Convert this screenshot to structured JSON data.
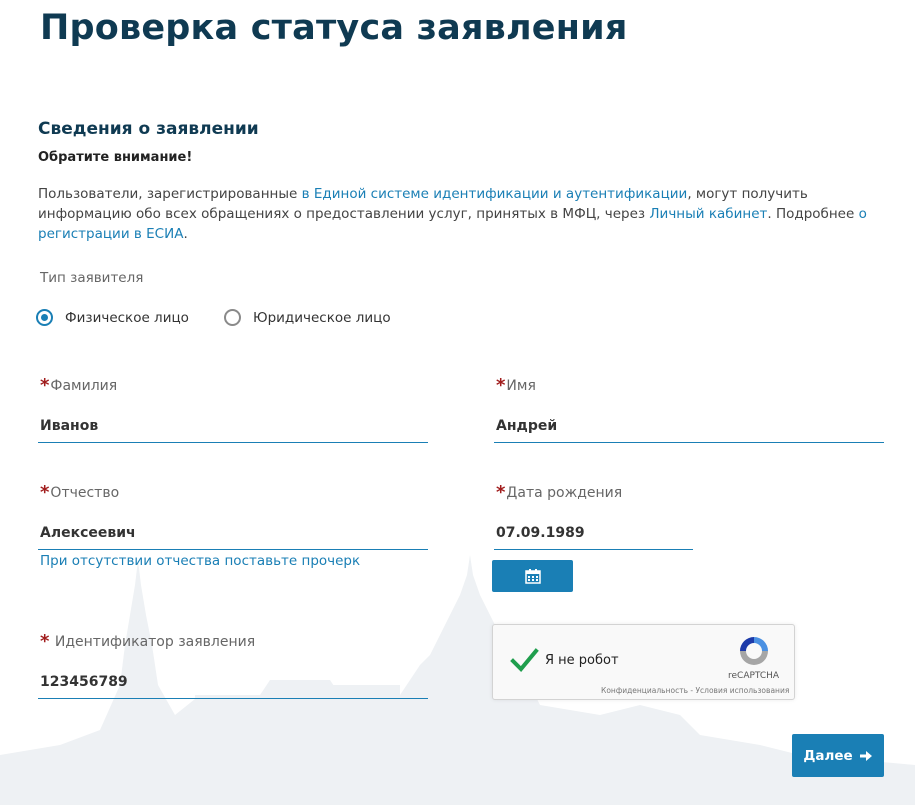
{
  "page": {
    "title": "Проверка статуса заявления"
  },
  "section": {
    "title": "Сведения о заявлении",
    "attention": "Обратите внимание!",
    "info": {
      "text1": "Пользователи, зарегистрированные ",
      "link1": "в Единой системе идентификации и аутентификации",
      "text2": ", могут получить информацию обо всех обращениях о предоставлении услуг, принятых в МФЦ, через ",
      "link2": "Личный кабинет",
      "text3": ". Подробнее ",
      "link3": "о регистрации в ЕСИА",
      "text4": "."
    }
  },
  "applicant_type": {
    "caption": "Тип заявителя",
    "options": [
      {
        "label": "Физическое лицо",
        "selected": true
      },
      {
        "label": "Юридическое лицо",
        "selected": false
      }
    ]
  },
  "form": {
    "required_mark": "*",
    "last_name": {
      "label": "Фамилия",
      "value": "Иванов"
    },
    "first_name": {
      "label": "Имя",
      "value": "Андрей"
    },
    "patronymic": {
      "label": "Отчество",
      "value": "Алексеевич",
      "hint": "При отсутствии отчества поставьте прочерк"
    },
    "birth_date": {
      "label": "Дата рождения",
      "value": "07.09.1989",
      "calendar_icon": "calendar-icon"
    },
    "application_id": {
      "label": "Идентификатор заявления",
      "value": "123456789"
    }
  },
  "captcha": {
    "label": "Я не робот",
    "checked": true,
    "brand": "reCAPTCHA",
    "links": "Конфиденциальность - Условия использования"
  },
  "actions": {
    "next_label": "Далее",
    "next_icon": "arrow-right-icon"
  },
  "colors": {
    "accent": "#1a7fb5",
    "title": "#0f3a52",
    "required": "#a11d1d",
    "check": "#1f9e4d"
  }
}
